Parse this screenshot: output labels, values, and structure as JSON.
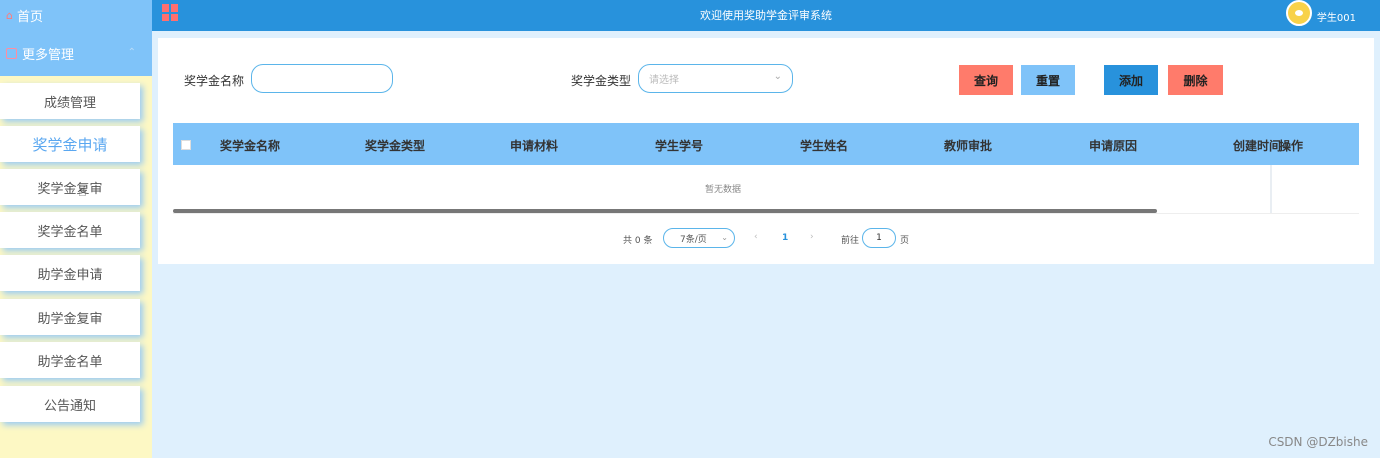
{
  "sidebar": {
    "home_label": "首页",
    "more_label": "更多管理",
    "items": [
      {
        "label": "成绩管理"
      },
      {
        "label": "奖学金申请"
      },
      {
        "label": "奖学金复审"
      },
      {
        "label": "奖学金名单"
      },
      {
        "label": "助学金申请"
      },
      {
        "label": "助学金复审"
      },
      {
        "label": "助学金名单"
      },
      {
        "label": "公告通知"
      }
    ]
  },
  "header": {
    "title": "欢迎使用奖助学金评审系统",
    "username": "学生001"
  },
  "search": {
    "name_label": "奖学金名称",
    "name_value": "",
    "type_label": "奖学金类型",
    "type_placeholder": "请选择"
  },
  "buttons": {
    "query": "查询",
    "reset": "重置",
    "add": "添加",
    "delete": "删除"
  },
  "table": {
    "columns": [
      "奖学金名称",
      "奖学金类型",
      "申请材料",
      "学生学号",
      "学生姓名",
      "教师审批",
      "申请原因",
      "创建时间"
    ],
    "ops_column": "操作",
    "empty_text": "暂无数据"
  },
  "pagination": {
    "total_text": "共 0 条",
    "page_size": "7条/页",
    "current_page": "1",
    "goto_label": "前往",
    "goto_value": "1",
    "page_suffix": "页"
  },
  "watermark": "CSDN @DZbishe",
  "colors": {
    "sidebar_active_bg": "#7fc3f9",
    "header_bg": "#2892dc",
    "query_btn": "#ff7b6b",
    "reset_btn": "#7fc3f9",
    "add_btn": "#2892dc",
    "delete_btn": "#ff7b6b"
  }
}
